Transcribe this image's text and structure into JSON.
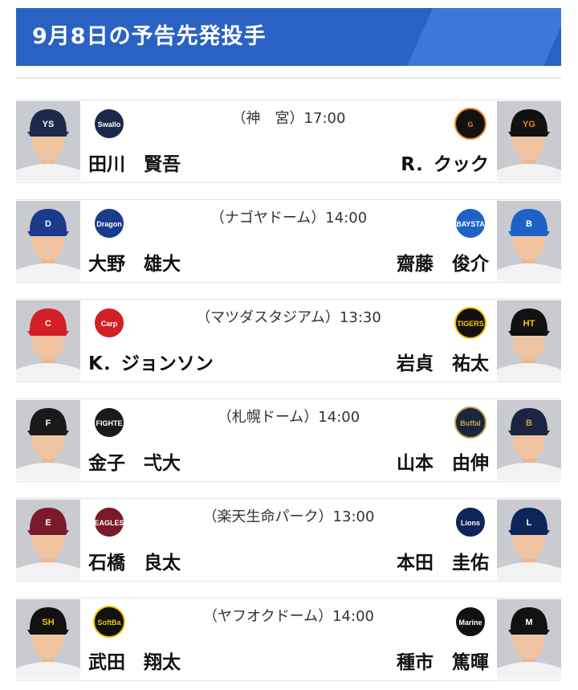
{
  "header": {
    "title": "9月8日の予告先発投手"
  },
  "colors": {
    "header": "#2a62c4",
    "header_band": "#3d78d8"
  },
  "games": [
    {
      "venue": "（神　宮）17:00",
      "home": {
        "pitcher": "田川　賢吾",
        "logo_text": "Swallows",
        "logo": "swallows-logo",
        "cap": "#1b2a4a",
        "cap_mark": "YS",
        "mark_color": "#ffffff"
      },
      "away": {
        "pitcher": "R．クック",
        "logo_text": "G",
        "logo": "giants-logo",
        "cap": "#111111",
        "cap_mark": "YG",
        "mark_color": "#f58220"
      }
    },
    {
      "venue": "（ナゴヤドーム）14:00",
      "home": {
        "pitcher": "大野　雄大",
        "logo_text": "Dragons",
        "logo": "dragons-logo",
        "cap": "#1a3a8c",
        "cap_mark": "D",
        "mark_color": "#ffffff"
      },
      "away": {
        "pitcher": "齋藤　俊介",
        "logo_text": "BAYSTARS",
        "logo": "baystars-logo",
        "cap": "#1e62c8",
        "cap_mark": "B",
        "mark_color": "#ffffff"
      }
    },
    {
      "venue": "（マツダスタジアム）13:30",
      "home": {
        "pitcher": "K．ジョンソン",
        "logo_text": "Carp",
        "logo": "carp-logo",
        "cap": "#d31f26",
        "cap_mark": "C",
        "mark_color": "#ffffff"
      },
      "away": {
        "pitcher": "岩貞　祐太",
        "logo_text": "TIGERS",
        "logo": "tigers-logo",
        "cap": "#111111",
        "cap_mark": "HT",
        "mark_color": "#f7c600"
      }
    },
    {
      "venue": "（札幌ドーム）14:00",
      "home": {
        "pitcher": "金子　弌大",
        "logo_text": "FIGHTERS",
        "logo": "fighters-logo",
        "cap": "#1a1a1a",
        "cap_mark": "F",
        "mark_color": "#ffffff"
      },
      "away": {
        "pitcher": "山本　由伸",
        "logo_text": "Buffaloes",
        "logo": "buffaloes-logo",
        "cap": "#1b2440",
        "cap_mark": "B",
        "mark_color": "#c8a54a"
      }
    },
    {
      "venue": "（楽天生命パーク）13:00",
      "home": {
        "pitcher": "石橋　良太",
        "logo_text": "EAGLES",
        "logo": "eagles-logo",
        "cap": "#7a1a2a",
        "cap_mark": "E",
        "mark_color": "#ffffff"
      },
      "away": {
        "pitcher": "本田　圭佑",
        "logo_text": "Lions",
        "logo": "lions-logo",
        "cap": "#0d2559",
        "cap_mark": "L",
        "mark_color": "#ffffff"
      }
    },
    {
      "venue": "（ヤフオクドーム）14:00",
      "home": {
        "pitcher": "武田　翔太",
        "logo_text": "SoftBank HAWKS",
        "logo": "hawks-logo",
        "cap": "#111111",
        "cap_mark": "SH",
        "mark_color": "#f2c200"
      },
      "away": {
        "pitcher": "種市　篤暉",
        "logo_text": "Marines",
        "logo": "marines-logo",
        "cap": "#111111",
        "cap_mark": "M",
        "mark_color": "#ffffff"
      }
    }
  ]
}
